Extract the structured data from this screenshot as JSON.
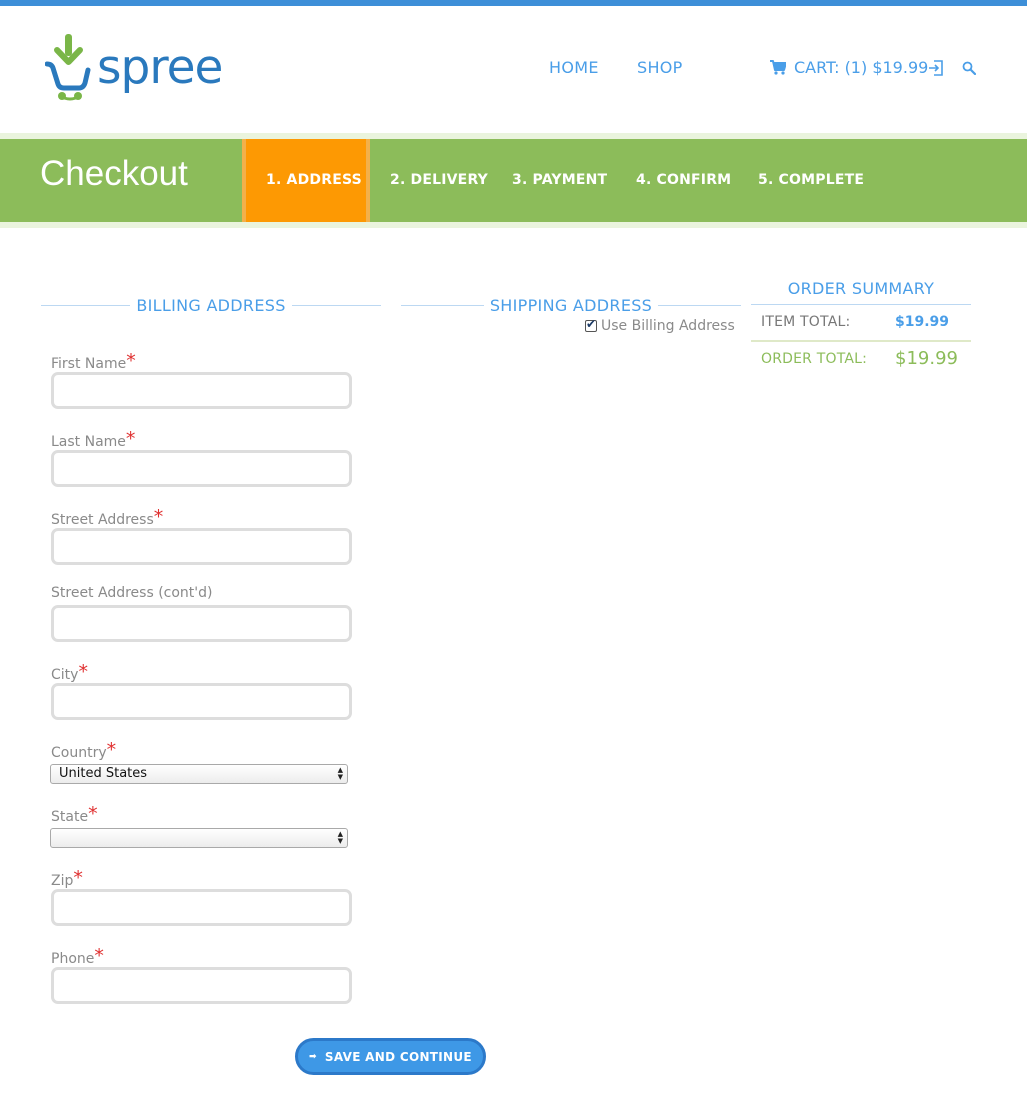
{
  "header": {
    "logo_text": "spree",
    "nav": {
      "home": "HOME",
      "shop": "SHOP"
    },
    "cart_label": "CART: (1) $19.99"
  },
  "checkout": {
    "title": "Checkout",
    "steps": [
      {
        "label": "1. ADDRESS",
        "active": true
      },
      {
        "label": "2. DELIVERY",
        "active": false
      },
      {
        "label": "3. PAYMENT",
        "active": false
      },
      {
        "label": "4. CONFIRM",
        "active": false
      },
      {
        "label": "5. COMPLETE",
        "active": false
      }
    ]
  },
  "billing": {
    "heading": "BILLING ADDRESS",
    "fields": {
      "first_name": {
        "label": "First Name",
        "required": "*",
        "value": ""
      },
      "last_name": {
        "label": "Last Name",
        "required": "*",
        "value": ""
      },
      "street": {
        "label": "Street Address",
        "required": "*",
        "value": ""
      },
      "street2": {
        "label": "Street Address (cont'd)",
        "value": ""
      },
      "city": {
        "label": "City",
        "required": "*",
        "value": ""
      },
      "country": {
        "label": "Country",
        "required": "*",
        "selected": "United States"
      },
      "state": {
        "label": "State",
        "required": "*",
        "selected": ""
      },
      "zip": {
        "label": "Zip",
        "required": "*",
        "value": ""
      },
      "phone": {
        "label": "Phone",
        "required": "*",
        "value": ""
      }
    }
  },
  "shipping": {
    "heading": "SHIPPING ADDRESS",
    "use_billing_label": "Use Billing Address",
    "use_billing_checked": true
  },
  "summary": {
    "heading": "ORDER SUMMARY",
    "item_total_label": "ITEM TOTAL:",
    "item_total_value": "$19.99",
    "order_total_label": "ORDER TOTAL:",
    "order_total_value": "$19.99"
  },
  "actions": {
    "save_label": "SAVE AND CONTINUE"
  },
  "colors": {
    "accent_blue": "#4a9ee8",
    "brand_green": "#8cbc5a",
    "active_step_orange": "#fd9903",
    "required_red": "#e03030"
  }
}
